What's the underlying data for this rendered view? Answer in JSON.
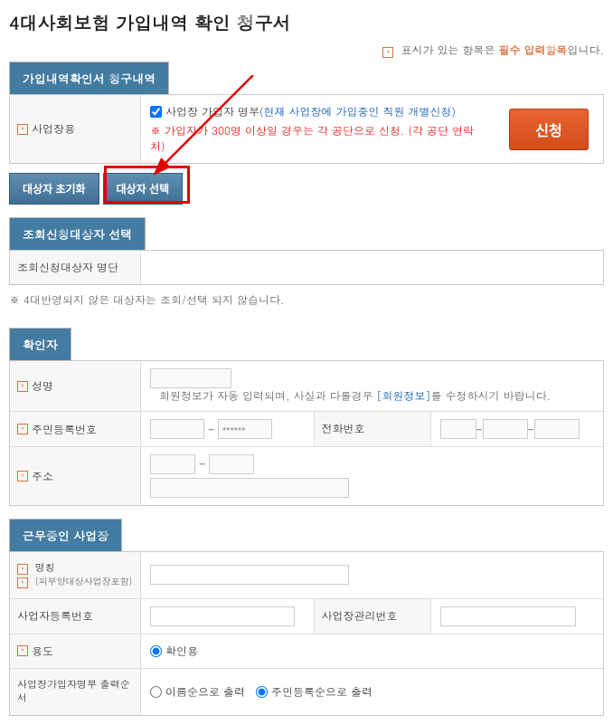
{
  "page_title": "4대사회보험 가입내역 확인 청구서",
  "required_note": {
    "prefix": "표시가 있는 항목은 ",
    "required_word": "필수 입력항목",
    "suffix": "입니다."
  },
  "section1": {
    "tab": "가입내역확인서 청구내역",
    "biz_type_label": "사업장용",
    "checkbox_label": "사업장 가입자 명부",
    "checkbox_desc": "(현재 사업장에 가입중인 직원 개별신청)",
    "warning": "※ 가입자가 300명 이상일 경우는 각 공단으로 신청. (각 공단 연락처)",
    "apply_btn": "신청"
  },
  "tabs": {
    "reset": "대상자 초기화",
    "select": "대상자 선택"
  },
  "section2": {
    "tab": "조회신청대상자 선택",
    "list_label": "조회신청대상자 명단"
  },
  "note": "※ 4대반영되지 않은 대상자는 조회/선택 되지 않습니다.",
  "section3": {
    "tab": "확인자",
    "name_label": "성명",
    "name_info_prefix": "회원정보가 자동 입력되며, 사실과 다를경우 ",
    "name_info_link": "[회원정보]",
    "name_info_suffix": "를 수정하시기 바랍니다.",
    "rrn_label": "주민등록번호",
    "phone_label": "전화번호",
    "addr_label": "주소"
  },
  "section4": {
    "tab": "근무중인 사업장",
    "name_label": "명칭",
    "sub_label": "(피부양대상사업장포함)",
    "regno_label": "사업자등록번호",
    "mgmtno_label": "사업장관리번호",
    "purpose_label": "용도",
    "purpose_value": "확인용",
    "order_label": "사업장가입자명부 출력순서",
    "order_opt1": "이름순으로 출력",
    "order_opt2": "주민등록순으로 출력"
  }
}
